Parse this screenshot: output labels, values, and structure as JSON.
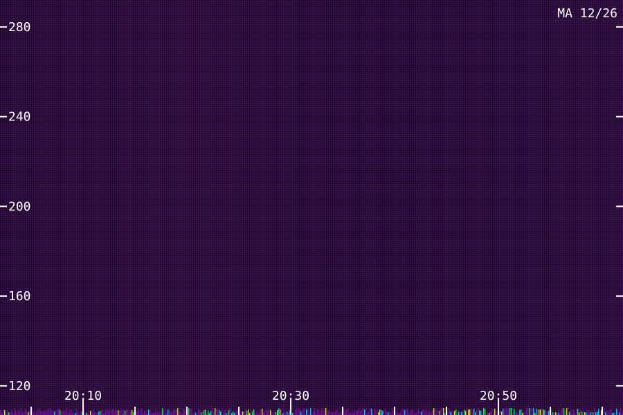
{
  "chart_data": {
    "type": "heatmap",
    "title": "MA 12/26",
    "y_ticks": [
      "280",
      "240",
      "200",
      "160",
      "120"
    ],
    "y_values": [
      280,
      240,
      200,
      160,
      120
    ],
    "ylim": [
      107,
      292
    ],
    "x_ticks": [
      "20:10",
      "20:30",
      "20:50"
    ],
    "x_values": [
      "20:10",
      "20:30",
      "20:50"
    ],
    "xlim": [
      "20:02",
      "21:02"
    ],
    "minor_x_ticks": [
      "20:05",
      "20:15",
      "20:20",
      "20:25",
      "20:35",
      "20:40",
      "20:45",
      "20:55",
      "21:00"
    ],
    "colors": {
      "background": "#2a0c3a",
      "low_intensity": "#6a1a8c",
      "high_intensity": [
        "#1fd0ff",
        "#3cf07a",
        "#e8ff40"
      ]
    },
    "grid": false
  }
}
